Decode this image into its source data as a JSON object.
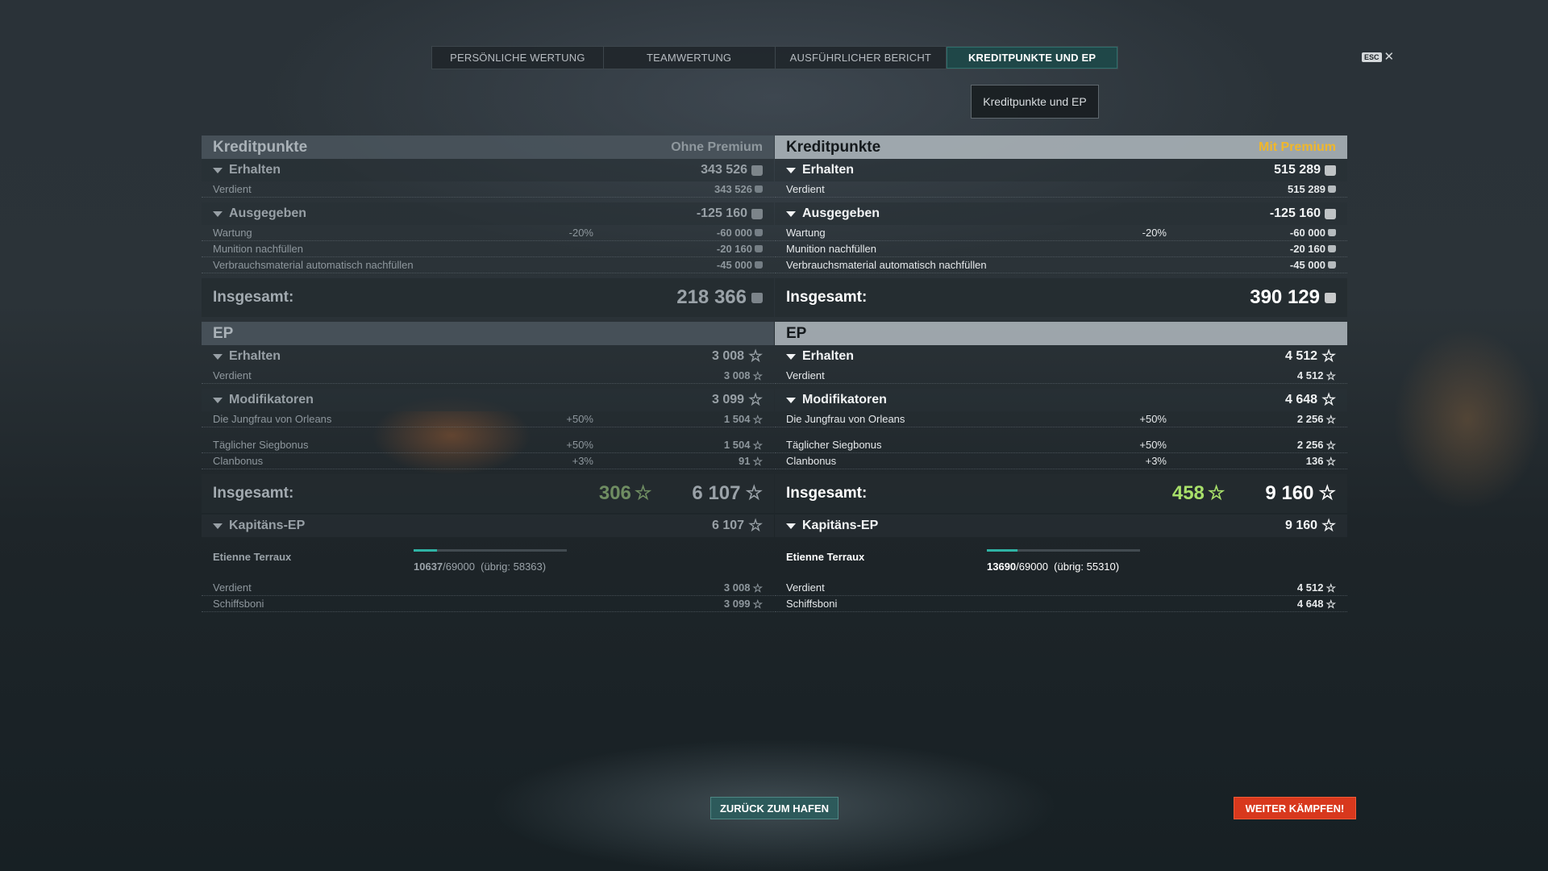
{
  "tabs": [
    {
      "label": "PERSÖNLICHE WERTUNG"
    },
    {
      "label": "TEAMWERTUNG"
    },
    {
      "label": "AUSFÜHRLICHER BERICHT"
    },
    {
      "label": "KREDITPUNKTE UND EP"
    }
  ],
  "active_tab_index": 3,
  "esc": {
    "key": "ESC",
    "close": "✕"
  },
  "tooltip": "Kreditpunkte und EP",
  "columns": [
    {
      "credits_title": "Kreditpunkte",
      "premium_tag": "Ohne Premium",
      "earned": {
        "label": "Erhalten",
        "value": "343 526"
      },
      "earned_rows": [
        {
          "label": "Verdient",
          "value": "343 526"
        }
      ],
      "spent": {
        "label": "Ausgegeben",
        "value": "-125 160"
      },
      "spent_rows": [
        {
          "label": "Wartung",
          "pct": "-20%",
          "value": "-60 000"
        },
        {
          "label": "Munition nachfüllen",
          "pct": "",
          "value": "-20 160"
        },
        {
          "label": "Verbrauchsmaterial automatisch nachfüllen",
          "pct": "",
          "value": "-45 000"
        }
      ],
      "credits_total": {
        "label": "Insgesamt:",
        "value": "218 366"
      },
      "xp_title": "EP",
      "xp_earned": {
        "label": "Erhalten",
        "value": "3 008"
      },
      "xp_earned_rows": [
        {
          "label": "Verdient",
          "value": "3 008"
        }
      ],
      "modifiers": {
        "label": "Modifikatoren",
        "value": "3 099"
      },
      "modifier_rows": [
        {
          "label": "Die Jungfrau von Orleans",
          "pct": "+50%",
          "value": "1 504"
        },
        {
          "label": "Täglicher Siegbonus",
          "pct": "+50%",
          "value": "1 504"
        },
        {
          "label": "Clanbonus",
          "pct": "+3%",
          "value": "91"
        }
      ],
      "xp_total": {
        "label": "Insgesamt:",
        "bonus": "306",
        "value": "6 107"
      },
      "captain": {
        "label": "Kapitäns-EP",
        "value": "6 107"
      },
      "captain_name": "Etienne Terraux",
      "captain_progress": {
        "current": "10637",
        "max": "/69000",
        "remaining": "(übrig: 58363)",
        "fraction": 0.154
      },
      "captain_rows": [
        {
          "label": "Verdient",
          "value": "3 008"
        },
        {
          "label": "Schiffsboni",
          "value": "3 099"
        }
      ]
    },
    {
      "credits_title": "Kreditpunkte",
      "premium_tag": "Mit Premium",
      "earned": {
        "label": "Erhalten",
        "value": "515 289"
      },
      "earned_rows": [
        {
          "label": "Verdient",
          "value": "515 289"
        }
      ],
      "spent": {
        "label": "Ausgegeben",
        "value": "-125 160"
      },
      "spent_rows": [
        {
          "label": "Wartung",
          "pct": "-20%",
          "value": "-60 000"
        },
        {
          "label": "Munition nachfüllen",
          "pct": "",
          "value": "-20 160"
        },
        {
          "label": "Verbrauchsmaterial automatisch nachfüllen",
          "pct": "",
          "value": "-45 000"
        }
      ],
      "credits_total": {
        "label": "Insgesamt:",
        "value": "390 129"
      },
      "xp_title": "EP",
      "xp_earned": {
        "label": "Erhalten",
        "value": "4 512"
      },
      "xp_earned_rows": [
        {
          "label": "Verdient",
          "value": "4 512"
        }
      ],
      "modifiers": {
        "label": "Modifikatoren",
        "value": "4 648"
      },
      "modifier_rows": [
        {
          "label": "Die Jungfrau von Orleans",
          "pct": "+50%",
          "value": "2 256"
        },
        {
          "label": "Täglicher Siegbonus",
          "pct": "+50%",
          "value": "2 256"
        },
        {
          "label": "Clanbonus",
          "pct": "+3%",
          "value": "136"
        }
      ],
      "xp_total": {
        "label": "Insgesamt:",
        "bonus": "458",
        "value": "9 160"
      },
      "captain": {
        "label": "Kapitäns-EP",
        "value": "9 160"
      },
      "captain_name": "Etienne Terraux",
      "captain_progress": {
        "current": "13690",
        "max": "/69000",
        "remaining": "(übrig: 55310)",
        "fraction": 0.198
      },
      "captain_rows": [
        {
          "label": "Verdient",
          "value": "4 512"
        },
        {
          "label": "Schiffsboni",
          "value": "4 648"
        }
      ]
    }
  ],
  "buttons": {
    "back": "ZURÜCK ZUM HAFEN",
    "fight": "WEITER KÄMPFEN!"
  },
  "icons": {
    "credit": "credit-coin-icon",
    "xp": "xp-star-icon",
    "star_glyph": "☆"
  },
  "colors": {
    "premium_tag": "#f0b72a",
    "active_tab": "#1f4748",
    "fight_button": "#d8381d",
    "back_button": "#2d5a5b",
    "bonus_xp": "#a8e06a",
    "progress": "#2fb3a4"
  }
}
